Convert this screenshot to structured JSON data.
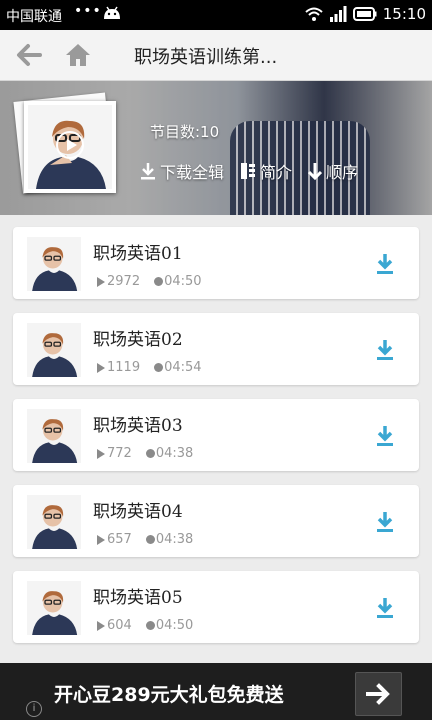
{
  "status_bar": {
    "carrier": "中国联通",
    "dots": "•••",
    "time": "15:10"
  },
  "title_bar": {
    "title": "职场英语训练第..."
  },
  "header": {
    "count_text": "节目数:10",
    "actions": {
      "download_all": "下载全辑",
      "intro": "简介",
      "order": "顺序"
    }
  },
  "items": [
    {
      "title": "职场英语01",
      "plays": "2972",
      "duration": "04:50"
    },
    {
      "title": "职场英语02",
      "plays": "1119",
      "duration": "04:54"
    },
    {
      "title": "职场英语03",
      "plays": "772",
      "duration": "04:38"
    },
    {
      "title": "职场英语04",
      "plays": "657",
      "duration": "04:38"
    },
    {
      "title": "职场英语05",
      "plays": "604",
      "duration": "04:50"
    }
  ],
  "ad": {
    "text": "开心豆289元大礼包免费送"
  },
  "colors": {
    "accent_download": "#3aa7d2",
    "ad_bg": "#1e1e1e"
  }
}
